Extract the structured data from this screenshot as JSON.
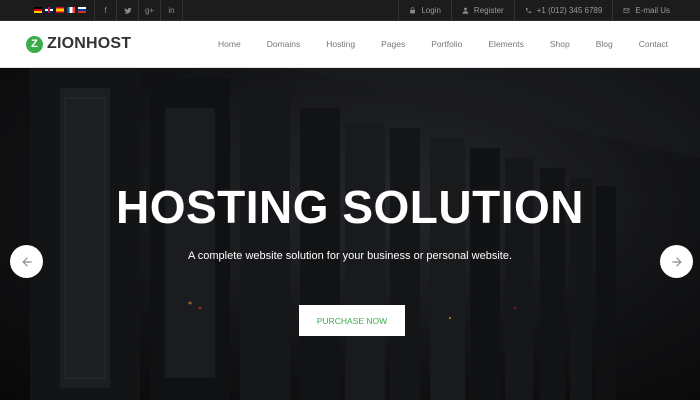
{
  "topbar": {
    "languages": [
      {
        "code": "de",
        "icon": "german-flag-icon"
      },
      {
        "code": "gb",
        "icon": "english-flag-icon"
      },
      {
        "code": "es",
        "icon": "spanish-flag-icon"
      },
      {
        "code": "fr",
        "icon": "french-flag-icon"
      },
      {
        "code": "ru",
        "icon": "russian-flag-icon"
      }
    ],
    "socials": [
      {
        "name": "facebook",
        "glyph": "f"
      },
      {
        "name": "twitter",
        "glyph": "t"
      },
      {
        "name": "google-plus",
        "glyph": "g+"
      },
      {
        "name": "linkedin",
        "glyph": "in"
      }
    ],
    "login_label": "Login",
    "register_label": "Register",
    "phone": "+1 (012) 345 6789",
    "email_label": "E-mail Us"
  },
  "header": {
    "logo_mark": "Z",
    "logo_text": "ZIONHOST",
    "nav": [
      "Home",
      "Domains",
      "Hosting",
      "Pages",
      "Portfolio",
      "Elements",
      "Shop",
      "Blog",
      "Contact"
    ]
  },
  "hero": {
    "title": "HOSTING SOLUTION",
    "subtitle": "A complete website solution for your business or personal website.",
    "cta_label": "PURCHASE NOW"
  },
  "colors": {
    "accent": "#3aad4a",
    "topbar_bg": "#1c1c1c",
    "header_bg": "#ffffff",
    "nav_text": "#777777"
  }
}
